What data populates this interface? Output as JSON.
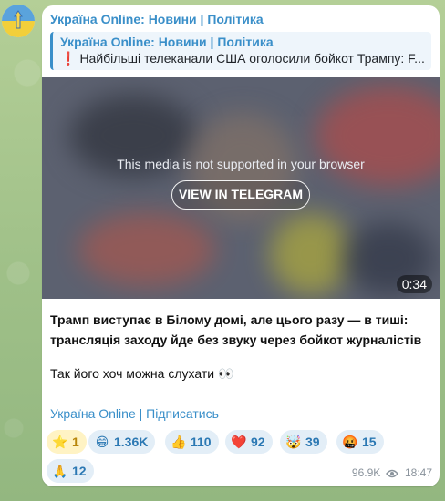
{
  "channel": {
    "name": "Україна Online: Новини | Політика"
  },
  "reply": {
    "title": "Україна Online: Новини | Політика",
    "text": "Найбільші телеканали США оголосили бойкот Трампу: F..."
  },
  "media": {
    "message": "This media is not supported in your browser",
    "button_label": "VIEW IN TELEGRAM",
    "duration": "0:34"
  },
  "post": {
    "caption": "Трамп виступає в Білому домі, але цього разу — в тиші: трансляція заходу йде без звуку через бойкот журналістів",
    "note": "Так його хоч можна слухати 👀",
    "link": "Україна Online | Підписатись"
  },
  "reactions": [
    {
      "emoji": "⭐",
      "count": "1",
      "icon": "star-icon"
    },
    {
      "emoji": "😁",
      "count": "1.36K",
      "icon": "grin-icon"
    },
    {
      "emoji": "👍",
      "count": "110",
      "icon": "thumbs-up-icon"
    },
    {
      "emoji": "❤️",
      "count": "92",
      "icon": "heart-icon"
    },
    {
      "emoji": "🤯",
      "count": "39",
      "icon": "mind-blown-icon"
    },
    {
      "emoji": "🤬",
      "count": "15",
      "icon": "swearing-face-icon"
    },
    {
      "emoji": "🙏",
      "count": "12",
      "icon": "pray-icon"
    }
  ],
  "meta": {
    "views": "96.9K",
    "time": "18:47"
  },
  "colors": {
    "accent": "#3a8fc9",
    "bubble": "#ffffff",
    "background": "#a9c68f"
  }
}
